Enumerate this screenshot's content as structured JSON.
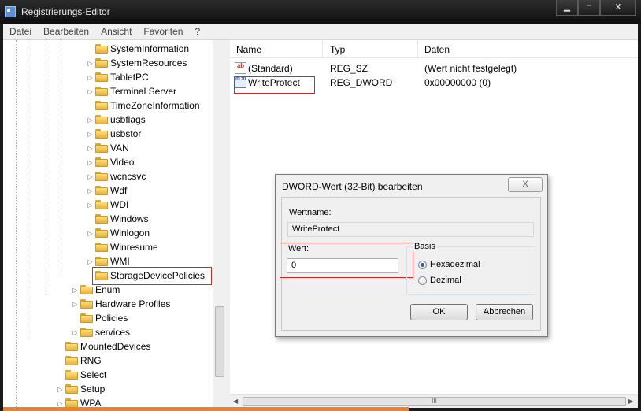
{
  "window": {
    "title": "Registrierungs-Editor",
    "minimize": "▁",
    "maximize": "□",
    "close": "X"
  },
  "menu": [
    "Datei",
    "Bearbeiten",
    "Ansicht",
    "Favoriten",
    "?"
  ],
  "tree": {
    "items": [
      "SystemInformation",
      "SystemResources",
      "TabletPC",
      "Terminal Server",
      "TimeZoneInformation",
      "usbflags",
      "usbstor",
      "VAN",
      "Video",
      "wcncsvc",
      "Wdf",
      "WDI",
      "Windows",
      "Winlogon",
      "Winresume",
      "WMI",
      "StorageDevicePolicies",
      "Enum",
      "Hardware Profiles",
      "Policies",
      "services",
      "MountedDevices",
      "RNG",
      "Select",
      "Setup",
      "WPA"
    ]
  },
  "list": {
    "columns": [
      "Name",
      "Typ",
      "Daten"
    ],
    "rows": [
      {
        "icon": "string-value-icon",
        "name": "(Standard)",
        "type": "REG_SZ",
        "data": "(Wert nicht festgelegt)"
      },
      {
        "icon": "binary-value-icon",
        "name": "WriteProtect",
        "type": "REG_DWORD",
        "data": "0x00000000 (0)"
      }
    ],
    "scrollbar_grip": "III"
  },
  "dialog": {
    "title": "DWORD-Wert (32-Bit) bearbeiten",
    "close": "X",
    "name_label": "Wertname:",
    "name_value": "WriteProtect",
    "value_label": "Wert:",
    "value": "0",
    "base_label": "Basis",
    "radio_hex": "Hexadezimal",
    "radio_dec": "Dezimal",
    "selected_base": "Hexadezimal",
    "ok": "OK",
    "cancel": "Abbrechen"
  },
  "colors": {
    "highlight": "#dd2222",
    "accent_bar": "#f27f2a"
  },
  "icons": {
    "ab": "ab",
    "bin": "01 10"
  }
}
